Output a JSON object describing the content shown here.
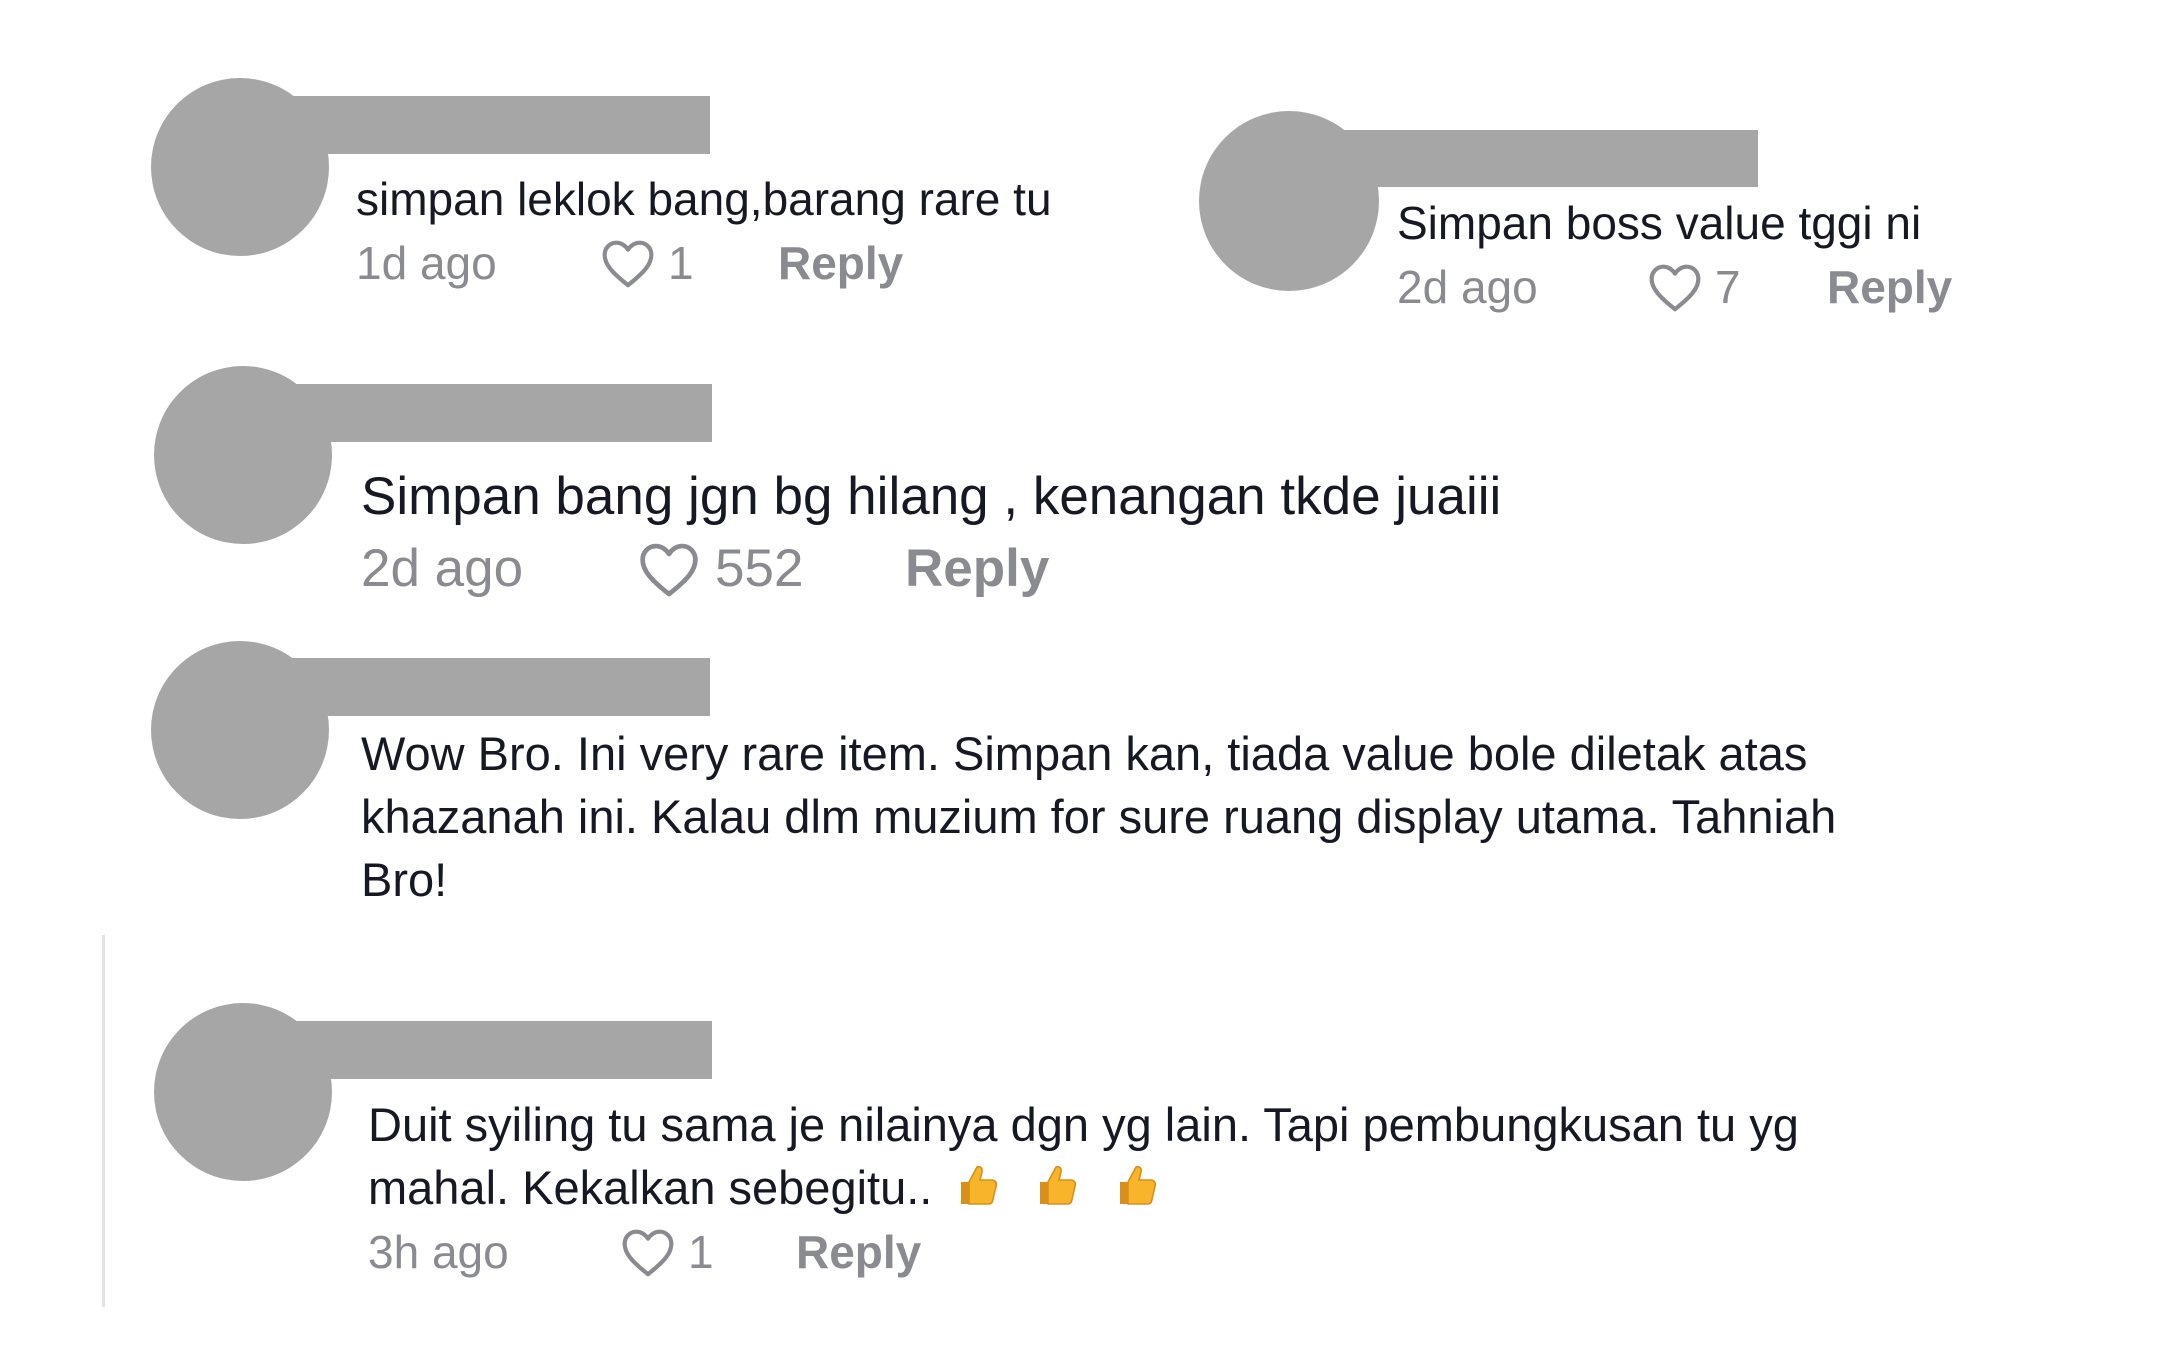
{
  "comments": [
    {
      "text": "simpan leklok bang,barang rare tu",
      "time": "1d ago",
      "likes": "1",
      "reply": "Reply"
    },
    {
      "text": "Simpan boss value tggi ni",
      "time": "2d ago",
      "likes": "7",
      "reply": "Reply"
    },
    {
      "text": "Simpan bang jgn bg hilang , kenangan tkde juaiii",
      "time": "2d ago",
      "likes": "552",
      "reply": "Reply"
    },
    {
      "lines": [
        "Wow Bro. Ini very rare item. Simpan kan, tiada value bole diletak atas",
        "khazanah ini. Kalau dlm muzium for sure ruang display utama. Tahniah",
        "Bro!"
      ]
    },
    {
      "lines": [
        "Duit syiling tu sama je nilainya dgn yg lain. Tapi pembungkusan tu yg",
        "mahal. Kekalkan sebegitu.."
      ],
      "emoji_icons": [
        "thumbs-up-icon",
        "thumbs-up-icon",
        "thumbs-up-icon"
      ],
      "time": "3h ago",
      "likes": "1",
      "reply": "Reply"
    }
  ],
  "colors": {
    "redaction": "#a6a6a6",
    "text": "#161823",
    "meta": "#8a8b91",
    "thread_line": "#e3e3e4"
  }
}
